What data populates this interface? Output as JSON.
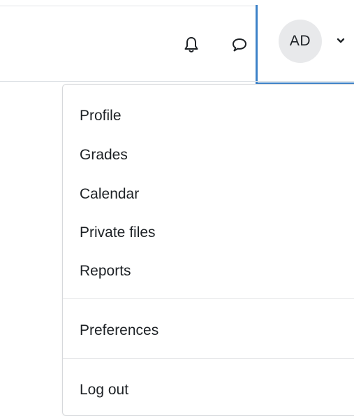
{
  "topbar": {
    "notifications_icon": "bell-icon",
    "messages_icon": "chat-bubble-icon",
    "user_initials": "AD",
    "caret_icon": "chevron-down-icon",
    "focus_color": "#3d82c8"
  },
  "user_menu": {
    "items": [
      {
        "label": "Profile"
      },
      {
        "label": "Grades"
      },
      {
        "label": "Calendar"
      },
      {
        "label": "Private files"
      },
      {
        "label": "Reports"
      },
      {
        "label": "Preferences"
      },
      {
        "label": "Log out"
      }
    ]
  }
}
